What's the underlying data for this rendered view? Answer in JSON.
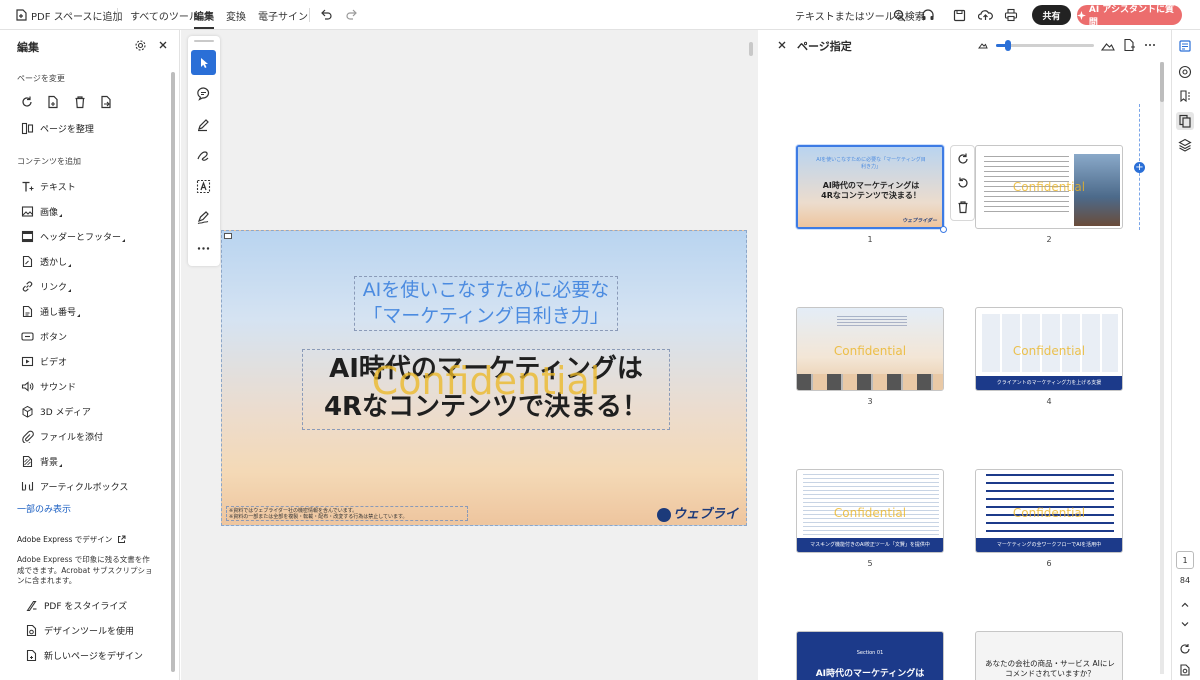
{
  "topbar": {
    "add_to_space": "PDF スペースに追加",
    "menus": [
      "すべてのツール",
      "編集",
      "変換",
      "電子サイン"
    ],
    "active_menu": "編集",
    "search_label": "テキストまたはツールを検索",
    "share_label": "共有",
    "ai_label": "AI アシスタントに質問"
  },
  "left_panel": {
    "title": "編集",
    "section_pages": "ページを変更",
    "organize_label": "ページを整理",
    "section_content": "コンテンツを追加",
    "items": [
      "テキスト",
      "画像",
      "ヘッダーとフッター",
      "透かし",
      "リンク",
      "通し番号",
      "ボタン",
      "ビデオ",
      "サウンド",
      "3D メディア",
      "ファイルを添付",
      "背景",
      "アーティクルボックス"
    ],
    "show_less": "一部のみ表示",
    "express_title": "Adobe Express でデザイン",
    "express_desc": "Adobe Express で印象に残る文書を作成できます。Acrobat サブスクリプションに含まれます。",
    "express_items": [
      "PDF をスタイライズ",
      "デザインツールを使用",
      "新しいページをデザイン"
    ]
  },
  "document": {
    "subtitle_line1": "AIを使いこなすために必要な",
    "subtitle_line2": "「マーケティング目利き力」",
    "main_line1": "AI時代のマーケティングは",
    "main_line2": "4Rなコンテンツで決まる！",
    "watermark": "Confidential",
    "note_line1": "※資料ではウェブライダー社の機密情報を含んでいます。",
    "note_line2": "※資料の一部または全部を複製・転載・配布・改変する行為は禁止しています。",
    "logo": "ウェブライダー"
  },
  "right_panel": {
    "title": "ページ指定",
    "thumbnails": [
      {
        "num": "1",
        "title_small": "AIを使いこなすために必要な「マーケティング目利き力」",
        "title_big": "AI時代のマーケティングは 4Rなコンテンツで決まる！",
        "banner": ""
      },
      {
        "num": "2",
        "title_small": "",
        "title_big": "",
        "banner": ""
      },
      {
        "num": "3",
        "title_small": "",
        "title_big": "",
        "banner": ""
      },
      {
        "num": "4",
        "title_small": "",
        "title_big": "",
        "banner": "クライアントのマーケティング力を上げる支援"
      },
      {
        "num": "5",
        "title_small": "",
        "title_big": "",
        "banner": "マスキング機能付きのAI校正ツール「文賢」を提供中"
      },
      {
        "num": "6",
        "title_small": "",
        "title_big": "",
        "banner": "マーケティングの全ワークフローでAIを活用中"
      },
      {
        "num": "",
        "title_small": "Section 01",
        "title_big": "AI時代のマーケティングは",
        "banner": ""
      },
      {
        "num": "",
        "title_small": "",
        "title_big": "あなたの会社の商品・サービス AIにレコメンドされていますか？",
        "banner": ""
      }
    ]
  },
  "nav": {
    "current_page": "1",
    "total_pages": "84"
  }
}
